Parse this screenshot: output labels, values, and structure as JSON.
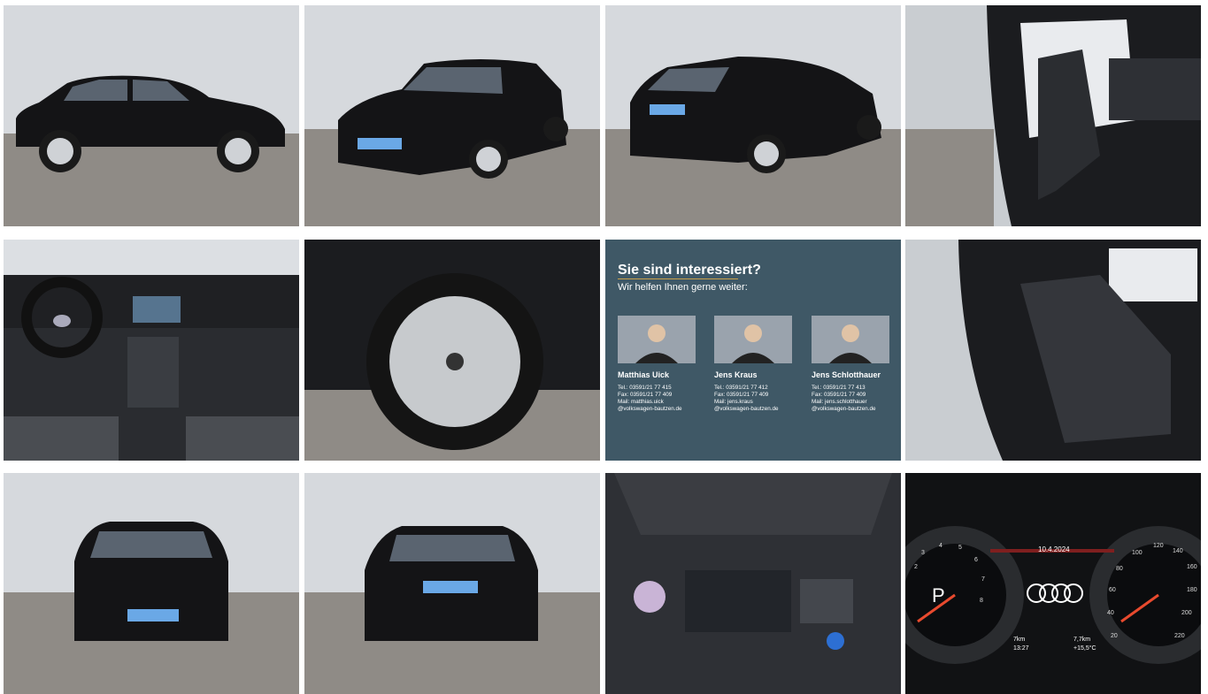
{
  "gallery": {
    "contact": {
      "heading": "Sie sind interessiert?",
      "subheading": "Wir helfen Ihnen gerne weiter:",
      "persons": [
        {
          "name": "Matthias Uick",
          "tel": "Tel.:  03591/21 77 415",
          "fax": "Fax:  03591/21 77 409",
          "mail": "Mail: matthias.uick",
          "domain": "@volkswagen-bautzen.de"
        },
        {
          "name": "Jens Kraus",
          "tel": "Tel.:    03591/21 77 412",
          "fax": "Fax:    03591/21 77 409",
          "mail": "Mail:   jens.kraus",
          "domain": "@volkswagen-bautzen.de"
        },
        {
          "name": "Jens Schlotthauer",
          "tel": "Tel.:  03591/21 77 413",
          "fax": "Fax:  03591/21 77 409",
          "mail": "Mail: jens.schlotthauer",
          "domain": "@volkswagen-bautzen.de"
        }
      ]
    },
    "cluster": {
      "gear": "P",
      "date": "10.4.2024",
      "range": "7km",
      "time": "13:27",
      "range2": "7,7km",
      "temp": "+15,5°C",
      "left_ticks": [
        "2",
        "3",
        "4",
        "5",
        "6",
        "7",
        "8"
      ],
      "right_ticks": [
        "20",
        "40",
        "60",
        "80",
        "100",
        "120",
        "140",
        "160",
        "180",
        "200",
        "220"
      ]
    },
    "colors": {
      "car": "#141416",
      "cobble": "#8f8b86",
      "wall": "#d6d9dd",
      "contact_bg": "#3f5866",
      "accent": "#c9a04a"
    }
  }
}
